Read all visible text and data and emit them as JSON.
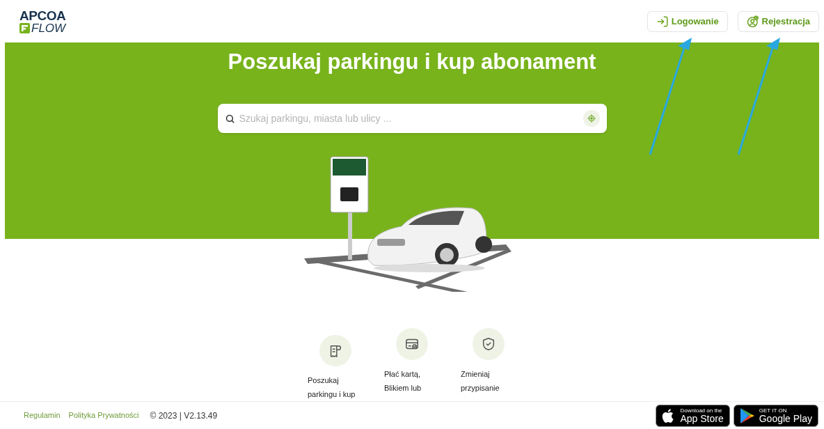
{
  "logo": {
    "top": "APCOA",
    "bottom": "FLOW"
  },
  "header_buttons": [
    {
      "kind": "login",
      "label": "Logowanie"
    },
    {
      "kind": "register",
      "label": "Rejestracja"
    }
  ],
  "hero": {
    "title": "Poszukaj parkingu i kup abonament",
    "search": {
      "placeholder": "Szukaj parkingu, miasta lub ulicy ..."
    }
  },
  "features": [
    {
      "kind": "receipt",
      "lines": [
        "Poszukaj",
        "parkingu i kup"
      ]
    },
    {
      "kind": "card",
      "lines": [
        "Płać kartą,",
        "Blikiem lub"
      ]
    },
    {
      "kind": "shield",
      "lines": [
        "Zmieniaj",
        "przypisanie"
      ]
    }
  ],
  "footer": {
    "links": [
      "Regulamin",
      "Polityka Prywatności"
    ],
    "version": "© 2023 | V2.13.49",
    "stores": [
      {
        "kind": "apple",
        "small": "Download on the",
        "big": "App Store"
      },
      {
        "kind": "google",
        "small": "GET IT ON",
        "big": "Google Play"
      }
    ]
  },
  "annotations": [
    {
      "kind": "arrow"
    },
    {
      "kind": "arrow"
    }
  ]
}
